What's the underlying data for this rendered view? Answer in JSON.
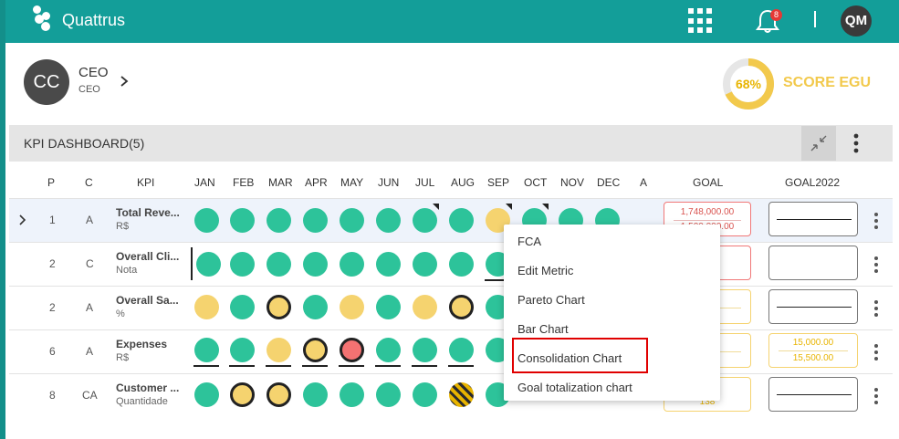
{
  "topbar": {
    "brand": "Quattrus",
    "notification_count": "8",
    "user_initials": "QM"
  },
  "profile": {
    "initials": "CC",
    "name": "CEO",
    "role": "CEO"
  },
  "score": {
    "percent_label": "68%",
    "value": 0.68,
    "label": "SCORE EGU",
    "color": "#f2c94c"
  },
  "dashboard": {
    "title": "KPI DASHBOARD(5)"
  },
  "columns": {
    "p": "P",
    "c": "C",
    "kpi": "KPI",
    "months": [
      "JAN",
      "FEB",
      "MAR",
      "APR",
      "MAY",
      "JUN",
      "JUL",
      "AUG",
      "SEP",
      "OCT",
      "NOV",
      "DEC"
    ],
    "a": "A",
    "goal": "GOAL",
    "goal2022": "GOAL2022"
  },
  "rows": [
    {
      "p": "1",
      "c": "A",
      "name": "Total Reve...",
      "unit": "R$",
      "goal_top": "1,748,000.00",
      "goal_bottom": "1,500,000.00",
      "goal22_top": "",
      "goal22_bottom": ""
    },
    {
      "p": "2",
      "c": "C",
      "name": "Overall Cli...",
      "unit": "Nota",
      "goal_top": "",
      "goal_bottom": "",
      "goal22_top": "",
      "goal22_bottom": ""
    },
    {
      "p": "2",
      "c": "A",
      "name": "Overall Sa...",
      "unit": "%",
      "goal_top": "0",
      "goal_bottom": "7",
      "goal22_top": "",
      "goal22_bottom": ""
    },
    {
      "p": "6",
      "c": "A",
      "name": "Expenses",
      "unit": "R$",
      "goal_top": "00",
      "goal_bottom": "00",
      "goal22_top": "15,000.00",
      "goal22_bottom": "15,500.00"
    },
    {
      "p": "8",
      "c": "CA",
      "name": "Customer ...",
      "unit": "Quantidade",
      "goal_top": "",
      "goal_bottom": "138",
      "goal22_top": "",
      "goal22_bottom": ""
    }
  ],
  "context_menu": {
    "items": [
      "FCA",
      "Edit Metric",
      "Pareto Chart",
      "Bar Chart",
      "Consolidation Chart",
      "Goal totalization chart"
    ],
    "highlighted": "Consolidation Chart"
  },
  "colors": {
    "teal": "#139e99",
    "green_status": "#2dc39a",
    "yellow_status": "#f5d36f",
    "red_status": "#f37272",
    "highlight": "#e00000"
  }
}
